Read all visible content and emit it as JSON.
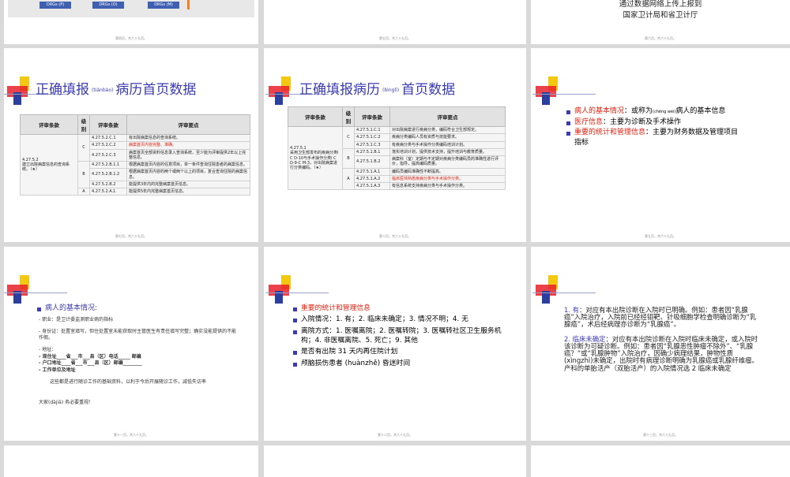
{
  "row1": {
    "s1": {
      "nodes": [
        "DRGs (P)",
        "DRGs (O)",
        "DRGs (M)"
      ],
      "footer": "第四页，共六十九页。"
    },
    "s2": {
      "footer": "第五页，共六十九页。"
    },
    "s3": {
      "lines": [
        "通过数据网络上传上报到",
        "国家卫计局和省卫计厅"
      ],
      "footer": "第六页，共六十九页。"
    }
  },
  "slide4": {
    "title_a": "正确填报",
    "title_ruby": "(tiánbào)",
    "title_b": "病历首页数据",
    "headers": [
      "评审条款",
      "级别",
      "评审条款",
      "评审要点"
    ],
    "left_cell": "4.27.5.2\n建立出院病案信息的查询系统。（★）",
    "rows": [
      {
        "level": "C",
        "code": "4.27.5.2.C.1",
        "text": "有出院病案信息的查询系统。",
        "red": false
      },
      {
        "level": "",
        "code": "4.27.5.2.C.2",
        "text": "病案首页内容完整、准确。",
        "red": true
      },
      {
        "level": "",
        "code": "4.27.5.2.C.3",
        "text": "病案首页全部资料信息录入查询系统，至少能为评审提供2年以上完整信息。",
        "red": false
      },
      {
        "level": "B",
        "code": "4.27.5.2.B.1.1",
        "text": "根据病案首页内容的任意项目，单一条件查询住院患者的病案信息。",
        "red": false
      },
      {
        "level": "",
        "code": "4.27.5.2.B.1.2",
        "text": "根据病案首页内容的两个或两个以上的项目，复合查询住院的病案信息。",
        "red": false
      },
      {
        "level": "",
        "code": "4.27.5.2.B.2",
        "text": "能提供3年内的完整病案首页信息。",
        "red": false
      },
      {
        "level": "A",
        "code": "4.27.5.2.A.1",
        "text": "能提供5年内完整病案首页信息。",
        "red": false
      }
    ],
    "footer": "第七页，共六十九页。"
  },
  "slide5": {
    "title_a": "正确填报病历",
    "title_ruby": "(bìnglì)",
    "title_b": "首页数据",
    "headers": [
      "评审条款",
      "级别",
      "评审条款",
      "评审要点"
    ],
    "left_cell": "4.27.5.1\n采用卫生部发布的疾病分类I C D-10与手术操作分类I C D-9-C M-3，对出院病案进行分类编码。（★）",
    "rows": [
      {
        "level": "C",
        "code": "4.27.5.1.C.1",
        "text": "对出院病案进行疾病分类，编码符合卫生部规定。",
        "red": false
      },
      {
        "level": "",
        "code": "4.27.5.1.C.2",
        "text": "疾病分类编码人员有资质与技能要求。",
        "red": false
      },
      {
        "level": "",
        "code": "4.27.5.1.C.3",
        "text": "有疾病分类与手术操作分类编码培训计划。",
        "red": false
      },
      {
        "level": "B",
        "code": "4.27.5.1.B.1",
        "text": "落实培训计划，提供技术支持，提升培训与教育质量。",
        "red": false
      },
      {
        "level": "",
        "code": "4.27.5.1.B.2",
        "text": "病案科（室）定期与不定期对疾病分类编码员的准确性进行评价，指导，提高编码质量。",
        "red": false
      },
      {
        "level": "A",
        "code": "4.27.5.1.A.1",
        "text": "编码员编码准确性不断提高。",
        "red": false
      },
      {
        "level": "",
        "code": "4.27.5.1.A.2",
        "text": "临床医师熟悉疾病分类与手术操作分类。",
        "red": true
      },
      {
        "level": "",
        "code": "4.27.5.1.A.3",
        "text": "有信息系统支持疾病分类与手术操作分类。",
        "red": false
      }
    ],
    "footer": "第八页，共六十九页。"
  },
  "slide6": {
    "b1_label": "病人的基本情况",
    "b1_a": "：或称为",
    "b1_ruby": "(chēng wéi)",
    "b1_b": "病人的基本信息",
    "b2_label": "医疗信息",
    "b2_text": "：主要为诊断及手术操作",
    "b3_label": "重要的统计和管理信息",
    "b3_text": "：主要为财务数据及管理项目指标",
    "footer": "第九页，共六十九页。"
  },
  "slide7": {
    "heading": "病人的基本情况:",
    "lines": [
      "- 职业：是卫计委监测职业病的指标",
      "",
      "- 身份证：处置室填写，但住处置室未能获取时主管医生有责任填写完整；确实没能提供的不能作假。",
      "",
      "- 地址：",
      "- 现住址____省___市___县（区）电话_____ 邮编",
      "- 户口地址____省___市___县（区）邮编________",
      "- 工作单位及地址",
      "",
      "这些都是进行随诊工作的基础资料，以利于今后开展随诊工作，减低失访率"
    ],
    "red_line": "大家(dàjiā) 务必要重视！",
    "footer": "第十一页，共六十九页。"
  },
  "slide8": {
    "heading": "重要的统计和管理信息",
    "items": [
      "入院情况：1. 有；2. 临床未确定；3. 情况不明；4. 无",
      "离院方式：1. 医嘱离院；2. 医嘱转院；3. 医嘱转社区卫生服务机构；4. 非医嘱离院、5. 死亡；9. 其他",
      "是否有出院 31 天内再住院计划",
      "颅脑损伤患者 (huànzhě) 昏迷时间"
    ],
    "footer": "第十二页，共六十九页。"
  },
  "slide9": {
    "p1_lead": "1. 有",
    "p1_text": "：对应有本出院诊断在入院时已明确。例如：患者因“乳腺癌”入院治疗，入院前已经经钼靶、针吸细胞学检查明确诊断为“乳腺癌”，术后经病理亦诊断为“乳腺癌”。",
    "p2_lead": "2. 临床未确定",
    "p2_text": "：对应有本出院诊断在入院时临床未确定，或入院时该诊断为可疑诊断。例如：患者因“乳腺恶性肿瘤不除外”、“乳腺癌？”或“乳腺肿物”入院治疗，因确少病理结果，肿物性质(xìngzhì)未确定，出院时有病理诊断明确为乳腺癌或乳腺纤维瘤。产科的单胎活产（双胎活产）的入院情况选 2 临床未确定",
    "footer": "第十三页，共六十九页。"
  }
}
